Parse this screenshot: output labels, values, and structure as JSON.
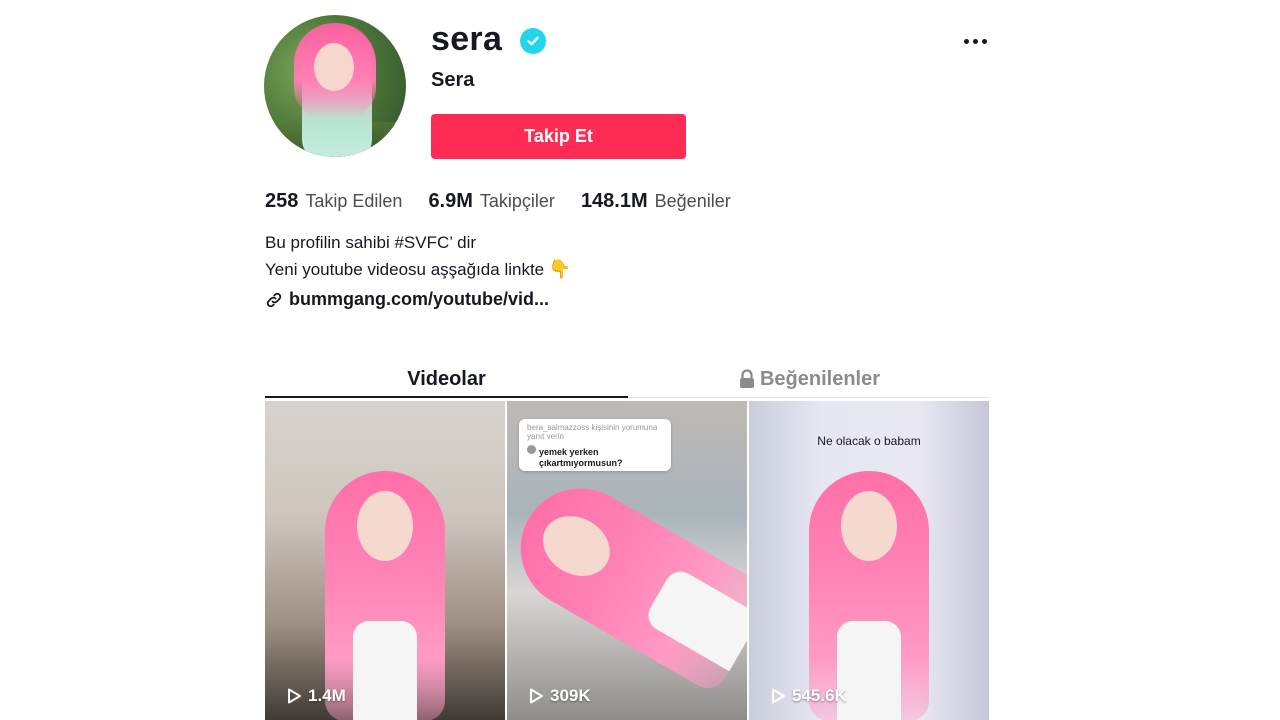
{
  "profile": {
    "username": "sera",
    "display_name": "Sera",
    "follow_label": "Takip Et",
    "verified": true
  },
  "stats": [
    {
      "value": "258",
      "label": "Takip Edilen"
    },
    {
      "value": "6.9M",
      "label": "Takipçiler"
    },
    {
      "value": "148.1M",
      "label": "Beğeniler"
    }
  ],
  "bio": {
    "line1": "Bu profilin sahibi #SVFC’ dir",
    "line2": "Yeni youtube videosu aşşağıda linkte",
    "line2_emoji": "👇"
  },
  "link": {
    "text": "bummgang.com/youtube/vid..."
  },
  "tabs": {
    "videos": "Videolar",
    "liked": "Beğenilenler"
  },
  "videos": [
    {
      "views": "1.4M",
      "caption": ""
    },
    {
      "views": "309K",
      "caption": "",
      "comment_header": "bera_salmazzoss kişisinin yorumuna yanıt verin",
      "comment_text": "yemek yerken çıkartmıyormusun?"
    },
    {
      "views": "545.6K",
      "caption": "Ne olacak o babam"
    }
  ],
  "colors": {
    "accent": "#fe2c55",
    "verified": "#20d5ec",
    "text": "#161823",
    "muted": "#8a8b91"
  }
}
